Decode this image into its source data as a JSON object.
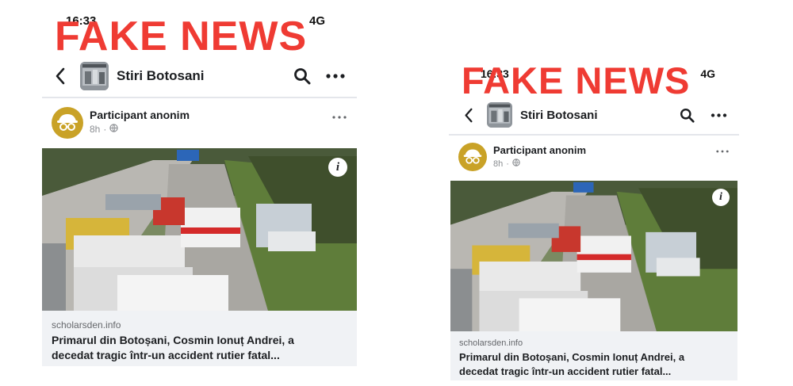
{
  "stamp": {
    "text": "FAKE NEWS",
    "color": "#ef3b33"
  },
  "status_bar": {
    "time": "16:33",
    "network": "4G"
  },
  "group": {
    "name": "Stiri Botosani"
  },
  "post": {
    "author": "Participant anonim",
    "time": "8h",
    "visibility_icon": "globe-icon",
    "link": {
      "domain": "scholarsden.info",
      "headline_line1": "Primarul din Botoșani, Cosmin Ionuț Andrei, a",
      "headline_line2": "decedat tragic într-un accident rutier fatal..."
    }
  },
  "icons": {
    "back": "chevron-left-icon",
    "search": "search-icon",
    "more": "more-horizontal-icon",
    "info": "info-icon"
  }
}
